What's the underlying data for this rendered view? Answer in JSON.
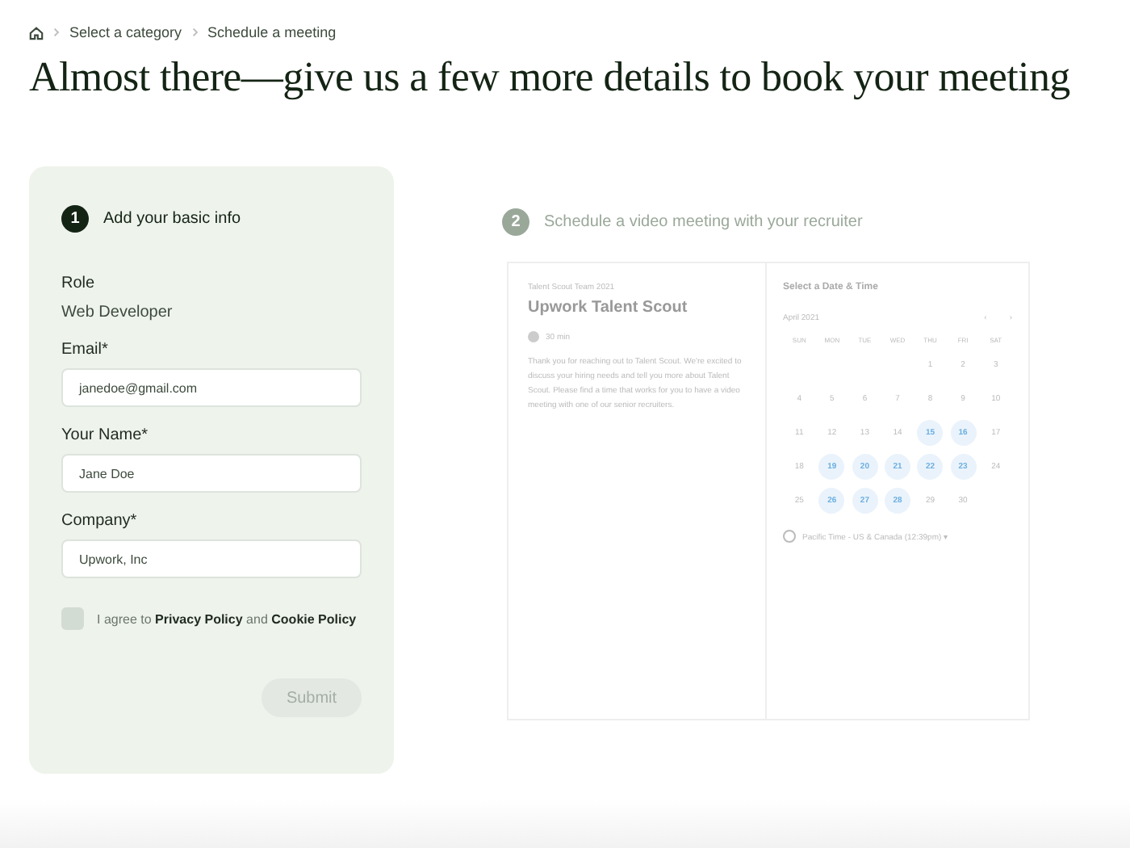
{
  "breadcrumbs": [
    {
      "label": "Select a category"
    },
    {
      "label": "Schedule a meeting"
    }
  ],
  "heading": "Almost there—give us a few more details to book your meeting",
  "steps": [
    {
      "number": "1",
      "label": "Add your basic info",
      "active": true
    },
    {
      "number": "2",
      "label": "Schedule a video meeting with your recruiter",
      "active": false
    }
  ],
  "form": {
    "role_label": "Role",
    "role_value": "Web Developer",
    "fields": [
      {
        "label": "Email*",
        "value": "janedoe@gmail.com"
      },
      {
        "label": "Your Name*",
        "value": "Jane Doe"
      },
      {
        "label": "Company*",
        "value": "Upwork, Inc"
      }
    ],
    "agree": {
      "checked": false,
      "text": "I agree to",
      "link_1": "Privacy Policy",
      "joiner": "and",
      "link_2": "Cookie Policy"
    },
    "submit": {
      "label": "Submit",
      "disabled": true
    }
  },
  "scheduler": {
    "team": "Talent Scout Team 2021",
    "title": "Upwork Talent Scout",
    "duration": "30 min",
    "description": "Thank you for reaching out to Talent Scout. We're excited to discuss your hiring needs and tell you more about Talent Scout. Please find a time that works for you to have a video meeting with one of our senior recruiters.",
    "calendar_title": "Select a Date & Time",
    "month": "April 2021",
    "prev": "‹",
    "next": "›",
    "weekdays": [
      "SUN",
      "MON",
      "TUE",
      "WED",
      "THU",
      "FRI",
      "SAT"
    ],
    "weeks": [
      [
        {
          "day": "1",
          "available": false
        },
        {
          "day": "2",
          "available": false
        },
        {
          "day": "3",
          "available": false
        }
      ],
      [
        {
          "day": "4",
          "available": false
        },
        {
          "day": "5",
          "available": false
        },
        {
          "day": "6",
          "available": false
        },
        {
          "day": "7",
          "available": false
        },
        {
          "day": "8",
          "available": false
        },
        {
          "day": "9",
          "available": false
        },
        {
          "day": "10",
          "available": false
        }
      ],
      [
        {
          "day": "11",
          "available": false
        },
        {
          "day": "12",
          "available": false
        },
        {
          "day": "13",
          "available": false
        },
        {
          "day": "14",
          "available": false
        },
        {
          "day": "15",
          "available": true
        },
        {
          "day": "16",
          "available": true
        },
        {
          "day": "17",
          "available": false
        }
      ],
      [
        {
          "day": "18",
          "available": false
        },
        {
          "day": "19",
          "available": true
        },
        {
          "day": "20",
          "available": true
        },
        {
          "day": "21",
          "available": true
        },
        {
          "day": "22",
          "available": true
        },
        {
          "day": "23",
          "available": true
        },
        {
          "day": "24",
          "available": false
        }
      ],
      [
        {
          "day": "25",
          "available": false
        },
        {
          "day": "26",
          "available": true
        },
        {
          "day": "27",
          "available": true
        },
        {
          "day": "28",
          "available": true
        },
        {
          "day": "29",
          "available": false
        },
        {
          "day": "30",
          "available": false
        }
      ]
    ],
    "timezone": "Pacific Time - US & Canada (12:39pm) ▾"
  }
}
